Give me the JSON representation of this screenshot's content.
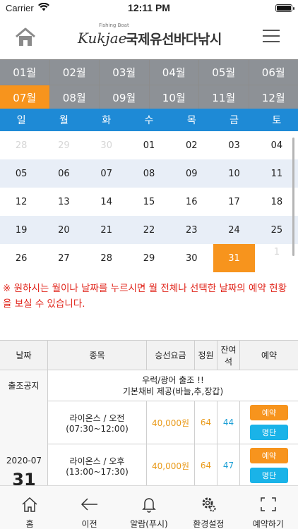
{
  "status_bar": {
    "carrier": "Carrier",
    "time": "12:11 PM",
    "battery_level": 1.0
  },
  "header": {
    "logo_script": "Kukjae",
    "logo_small": "Fishing Boat",
    "logo_name": "국제유선바다낚시",
    "home_icon": "home-icon",
    "menu_icon": "hamburger-menu-icon"
  },
  "months": [
    "01월",
    "02월",
    "03월",
    "04월",
    "05월",
    "06월",
    "07월",
    "08월",
    "09월",
    "10월",
    "11월",
    "12월"
  ],
  "selected_month": "07월",
  "weekdays": [
    "일",
    "월",
    "화",
    "수",
    "목",
    "금",
    "토"
  ],
  "weeks": [
    [
      "28",
      "29",
      "30",
      "01",
      "02",
      "03",
      "04"
    ],
    [
      "05",
      "06",
      "07",
      "08",
      "09",
      "10",
      "11"
    ],
    [
      "12",
      "13",
      "14",
      "15",
      "16",
      "17",
      "18"
    ],
    [
      "19",
      "20",
      "21",
      "22",
      "23",
      "24",
      "25"
    ],
    [
      "26",
      "27",
      "28",
      "29",
      "30",
      "31",
      "1"
    ]
  ],
  "selected_day": "31",
  "notice": "※ 원하시는 월이나 날짜를 누르시면 월 전체나 선택한 날짜의 예약 현황을 보실 수 있습니다.",
  "table": {
    "headers": [
      "날짜",
      "종목",
      "승선요금",
      "정원",
      "잔여석",
      "예약"
    ],
    "notice_label": "출조공지",
    "notice_line1": "우럭/광어 출조 !!",
    "notice_line2": "기본채비 제공(바늘,추,장갑)",
    "date_ym": "2020-07",
    "date_day": "31",
    "rows": [
      {
        "trip": "라이온스 / 오전",
        "time": "(07:30~12:00)",
        "fare": "40,000원",
        "capacity": "64",
        "remaining": "44",
        "reserve": "예약",
        "list": "명단"
      },
      {
        "trip": "라이온스 / 오후",
        "time": "(13:00~17:30)",
        "fare": "40,000원",
        "capacity": "64",
        "remaining": "47",
        "reserve": "예약",
        "list": "명단"
      }
    ]
  },
  "bottom_nav": [
    {
      "label": "홈",
      "icon": "home-icon"
    },
    {
      "label": "이전",
      "icon": "back-arrow-icon"
    },
    {
      "label": "알람(푸시)",
      "icon": "bell-icon"
    },
    {
      "label": "환경설정",
      "icon": "gear-icon"
    },
    {
      "label": "예약하기",
      "icon": "fullscreen-icon"
    }
  ],
  "colors": {
    "accent_orange": "#f7941d",
    "weekday_blue": "#1e8ad6",
    "month_gray": "#8d9196",
    "notice_red": "#e1261c",
    "list_blue": "#1ab3e8"
  }
}
